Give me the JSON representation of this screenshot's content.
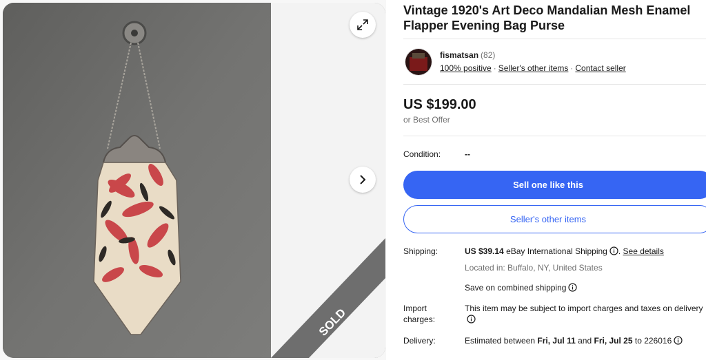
{
  "listing": {
    "title_line1": "Vintage 1920's Art Deco Mandalian Mesh Enamel",
    "title_line2": "Flapper Evening Bag Purse",
    "sold_label": "SOLD"
  },
  "gallery": {
    "expand_icon": "expand-icon",
    "next_icon": "chevron-right-icon"
  },
  "seller": {
    "name": "fismatsan",
    "feedback_count": "(82)",
    "positive": "100% positive",
    "other_items_link": "Seller's other items",
    "contact_link": "Contact seller",
    "separator": "·"
  },
  "price": {
    "amount": "US $199.00",
    "offer": "or Best Offer"
  },
  "condition": {
    "label": "Condition:",
    "value": "--"
  },
  "actions": {
    "sell_one": "Sell one like this",
    "sellers_other_items": "Seller's other items"
  },
  "shipping": {
    "label": "Shipping:",
    "cost": "US $39.14",
    "method": "eBay International Shipping",
    "see_details": "See details",
    "location": "Located in: Buffalo, NY, United States",
    "combined": "Save on combined shipping"
  },
  "import": {
    "label_line1": "Import",
    "label_line2": "charges:",
    "text": "This item may be subject to import charges and taxes on delivery"
  },
  "delivery": {
    "label": "Delivery:",
    "prefix": "Estimated between",
    "date1": "Fri, Jul 11",
    "and": "and",
    "date2": "Fri, Jul 25",
    "to": "to 226016"
  },
  "colors": {
    "primary": "#3665f3",
    "text": "#191919",
    "muted": "#707070",
    "sold_band": "#6e6e6e"
  }
}
